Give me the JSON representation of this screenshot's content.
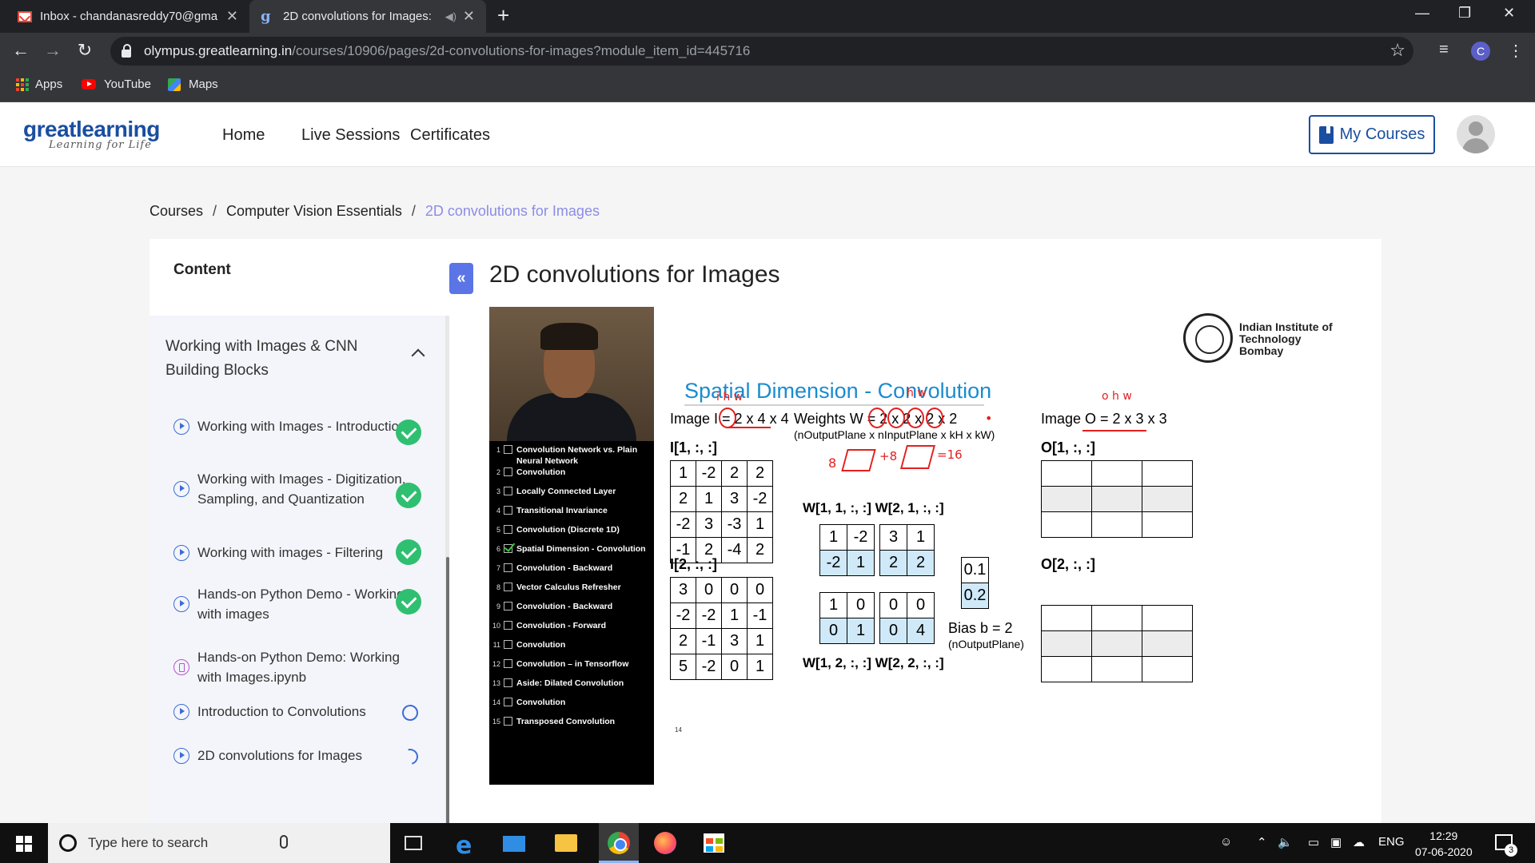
{
  "browser": {
    "tabs": [
      {
        "title": "Inbox - chandanasreddy70@gma",
        "icon": "gmail-icon",
        "active": false
      },
      {
        "title": "2D convolutions for Images:",
        "icon": "greatlearning-icon",
        "active": true
      }
    ],
    "url_host": "olympus.greatlearning.in",
    "url_path": "/courses/10906/pages/2d-convolutions-for-images?module_item_id=445716",
    "profile_initial": "C",
    "bookmarks": [
      {
        "label": "Apps",
        "icon": "apps-grid-icon"
      },
      {
        "label": "YouTube",
        "icon": "youtube-icon"
      },
      {
        "label": "Maps",
        "icon": "maps-icon"
      }
    ]
  },
  "site": {
    "logo": {
      "great": "great",
      "learning": "learning",
      "tagline": "Learning for Life"
    },
    "nav": [
      "Home",
      "Live Sessions",
      "Certificates"
    ],
    "my_courses": "My Courses"
  },
  "breadcrumb": {
    "items": [
      "Courses",
      "Computer Vision Essentials"
    ],
    "separator": "/",
    "current": "2D convolutions for Images"
  },
  "sidebar": {
    "title": "Content",
    "collapse_label": "«",
    "module_title": "Working with Images & CNN Building Blocks",
    "lessons": [
      {
        "label": "Working with Images - Introduction",
        "type": "video",
        "status": "completed"
      },
      {
        "label": "Working with Images - Digitization, Sampling, and Quantization",
        "type": "video",
        "status": "completed"
      },
      {
        "label": "Working with images - Filtering",
        "type": "video",
        "status": "completed"
      },
      {
        "label": "Hands-on Python Demo - Working with images",
        "type": "video",
        "status": "completed"
      },
      {
        "label": "Hands-on Python Demo: Working with Images.ipynb",
        "type": "notebook",
        "status": "none"
      },
      {
        "label": "Introduction to Convolutions",
        "type": "video",
        "status": "not-started"
      },
      {
        "label": "2D convolutions for Images",
        "type": "video",
        "status": "in-progress"
      }
    ]
  },
  "main": {
    "title": "2D convolutions for Images"
  },
  "video": {
    "toc": [
      {
        "n": "1",
        "text": "Convolution Network vs. Plain Neural Network",
        "checked": false
      },
      {
        "n": "2",
        "text": "Convolution",
        "checked": false
      },
      {
        "n": "3",
        "text": "Locally Connected Layer",
        "checked": false
      },
      {
        "n": "4",
        "text": "Transitional Invariance",
        "checked": false
      },
      {
        "n": "5",
        "text": "Convolution (Discrete 1D)",
        "checked": false
      },
      {
        "n": "6",
        "text": "Spatial Dimension - Convolution",
        "checked": true
      },
      {
        "n": "7",
        "text": "Convolution - Backward",
        "checked": false
      },
      {
        "n": "8",
        "text": "Vector Calculus Refresher",
        "checked": false
      },
      {
        "n": "9",
        "text": "Convolution - Backward",
        "checked": false
      },
      {
        "n": "10",
        "text": "Convolution - Forward",
        "checked": false
      },
      {
        "n": "11",
        "text": "Convolution",
        "checked": false
      },
      {
        "n": "12",
        "text": "Convolution – in Tensorflow",
        "checked": false
      },
      {
        "n": "13",
        "text": "Aside: Dilated Convolution",
        "checked": false
      },
      {
        "n": "14",
        "text": "Convolution",
        "checked": false
      },
      {
        "n": "15",
        "text": "Transposed Convolution",
        "checked": false
      }
    ],
    "slide": {
      "institute_line1": "Indian Institute of",
      "institute_line2": "Technology Bombay",
      "heading": "Spatial Dimension - Convolution",
      "image_i_label": "Image I = 2 x 4 x 4",
      "weights_label": "Weights W = 2 x 2 x 2 x 2",
      "weights_sub": "(nOutputPlane x nInputPlane x kH x kW)",
      "image_o_label": "Image O = 2 x 3 x 3",
      "i1_label": "I[1, :, :]",
      "i2_label": "I[2, :, :]",
      "i1": [
        [
          "1",
          "-2",
          "2",
          "2"
        ],
        [
          "2",
          "1",
          "3",
          "-2"
        ],
        [
          "-2",
          "3",
          "-3",
          "1"
        ],
        [
          "-1",
          "2",
          "-4",
          "2"
        ]
      ],
      "i2": [
        [
          "3",
          "0",
          "0",
          "0"
        ],
        [
          "-2",
          "-2",
          "1",
          "-1"
        ],
        [
          "2",
          "-1",
          "3",
          "1"
        ],
        [
          "5",
          "-2",
          "0",
          "1"
        ]
      ],
      "w_top_labels": "W[1, 1, :, :] W[2, 1, :, :]",
      "w_bottom_labels": "W[1, 2, :, :] W[2, 2, :, :]",
      "w11": [
        [
          "1",
          "-2"
        ],
        [
          "-2",
          "1"
        ]
      ],
      "w21": [
        [
          "3",
          "1"
        ],
        [
          "2",
          "2"
        ]
      ],
      "w12": [
        [
          "1",
          "0"
        ],
        [
          "0",
          "1"
        ]
      ],
      "w22": [
        [
          "0",
          "0"
        ],
        [
          "0",
          "4"
        ]
      ],
      "bias": [
        [
          "0.1"
        ],
        [
          "0.2"
        ]
      ],
      "bias_label": "Bias b = 2",
      "bias_sub": "(nOutputPlane)",
      "o1_label": "O[1, :, :]",
      "o2_label": "O[2, :, :]",
      "slide_number": "14",
      "annotations": {
        "dims_i": "i  h  w",
        "dims_o": "o  h  w",
        "dims_w": "h   w",
        "cube_expr_left": "8",
        "cube_expr_mid": "+8",
        "cube_expr_right": "=16"
      }
    }
  },
  "taskbar": {
    "search_placeholder": "Type here to search",
    "language": "ENG",
    "time": "12:29",
    "date": "07-06-2020",
    "notifications": "3"
  }
}
